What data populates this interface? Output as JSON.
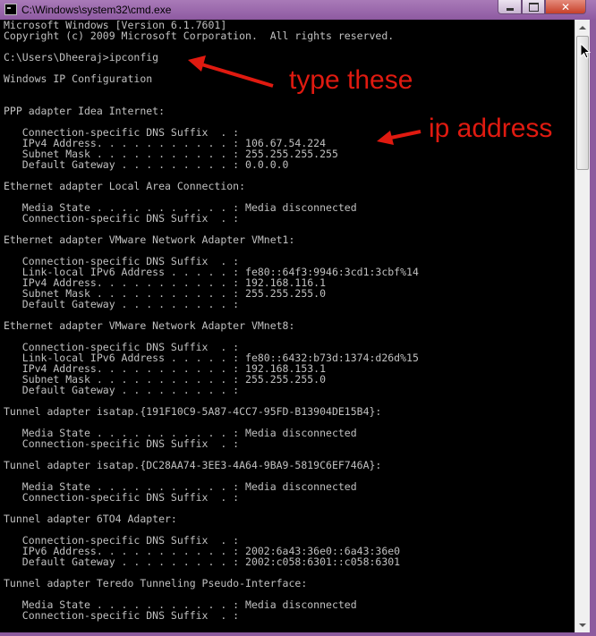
{
  "window": {
    "title": "C:\\Windows\\system32\\cmd.exe",
    "close_glyph": "✕"
  },
  "console": {
    "lines": [
      "Microsoft Windows [Version 6.1.7601]",
      "Copyright (c) 2009 Microsoft Corporation.  All rights reserved.",
      "",
      "C:\\Users\\Dheeraj>ipconfig",
      "",
      "Windows IP Configuration",
      "",
      "",
      "PPP adapter Idea Internet:",
      "",
      "   Connection-specific DNS Suffix  . :",
      "   IPv4 Address. . . . . . . . . . . : 106.67.54.224",
      "   Subnet Mask . . . . . . . . . . . : 255.255.255.255",
      "   Default Gateway . . . . . . . . . : 0.0.0.0",
      "",
      "Ethernet adapter Local Area Connection:",
      "",
      "   Media State . . . . . . . . . . . : Media disconnected",
      "   Connection-specific DNS Suffix  . :",
      "",
      "Ethernet adapter VMware Network Adapter VMnet1:",
      "",
      "   Connection-specific DNS Suffix  . :",
      "   Link-local IPv6 Address . . . . . : fe80::64f3:9946:3cd1:3cbf%14",
      "   IPv4 Address. . . . . . . . . . . : 192.168.116.1",
      "   Subnet Mask . . . . . . . . . . . : 255.255.255.0",
      "   Default Gateway . . . . . . . . . :",
      "",
      "Ethernet adapter VMware Network Adapter VMnet8:",
      "",
      "   Connection-specific DNS Suffix  . :",
      "   Link-local IPv6 Address . . . . . : fe80::6432:b73d:1374:d26d%15",
      "   IPv4 Address. . . . . . . . . . . : 192.168.153.1",
      "   Subnet Mask . . . . . . . . . . . : 255.255.255.0",
      "   Default Gateway . . . . . . . . . :",
      "",
      "Tunnel adapter isatap.{191F10C9-5A87-4CC7-95FD-B13904DE15B4}:",
      "",
      "   Media State . . . . . . . . . . . : Media disconnected",
      "   Connection-specific DNS Suffix  . :",
      "",
      "Tunnel adapter isatap.{DC28AA74-3EE3-4A64-9BA9-5819C6EF746A}:",
      "",
      "   Media State . . . . . . . . . . . : Media disconnected",
      "   Connection-specific DNS Suffix  . :",
      "",
      "Tunnel adapter 6TO4 Adapter:",
      "",
      "   Connection-specific DNS Suffix  . :",
      "   IPv6 Address. . . . . . . . . . . : 2002:6a43:36e0::6a43:36e0",
      "   Default Gateway . . . . . . . . . : 2002:c058:6301::c058:6301",
      "",
      "Tunnel adapter Teredo Tunneling Pseudo-Interface:",
      "",
      "   Media State . . . . . . . . . . . : Media disconnected",
      "   Connection-specific DNS Suffix  . :"
    ]
  },
  "annotations": {
    "type_these": "type these",
    "ip_address": "ip address",
    "color": "#e01a10"
  },
  "colors": {
    "console_bg": "#000000",
    "console_fg": "#c0c0c0",
    "titlebar": "#8e5aa1"
  }
}
